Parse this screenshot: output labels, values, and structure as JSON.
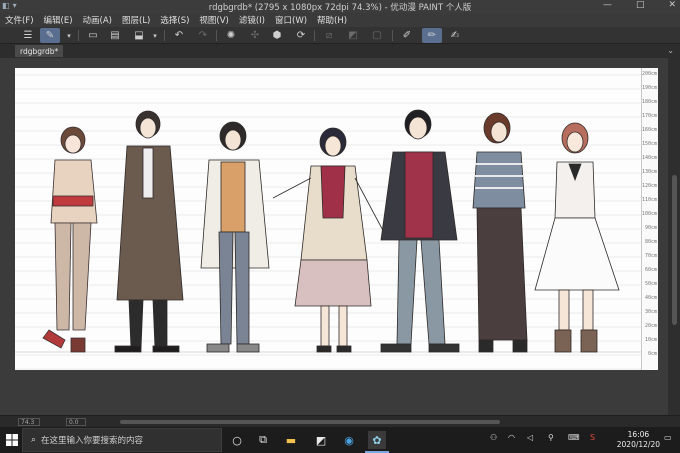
{
  "window": {
    "title": "rdgbgrdb* (2795 x 1080px 72dpi 74.3%)  - 优动漫 PAINT 个人版",
    "controls": [
      "—",
      "□",
      "✕"
    ]
  },
  "menu": [
    "文件(F)",
    "编辑(E)",
    "动画(A)",
    "图层(L)",
    "选择(S)",
    "视图(V)",
    "滤镜(I)",
    "窗口(W)",
    "帮助(H)"
  ],
  "toolbar": {
    "icons": [
      "menu-icon",
      "pen-icon",
      "new-icon",
      "open-icon",
      "save-icon",
      "undo-icon",
      "redo-icon",
      "select-icon",
      "transform-icon",
      "fill-icon",
      "ruler-icon",
      "gradient-icon",
      "frame-icon",
      "pen-tool-icon",
      "pencil-icon",
      "brush-icon"
    ]
  },
  "document_tab": {
    "label": "rdgbgrdb*"
  },
  "canvas": {
    "ruler_labels": [
      "200cm",
      "190cm",
      "180cm",
      "170cm",
      "160cm",
      "150cm",
      "140cm",
      "130cm",
      "120cm",
      "110cm",
      "100cm",
      "90cm",
      "80cm",
      "70cm",
      "60cm",
      "50cm",
      "40cm",
      "30cm",
      "20cm",
      "10cm",
      "0cm"
    ]
  },
  "statusbar": {
    "zoom": "74.3",
    "angle": "0.0"
  },
  "taskbar": {
    "search_placeholder": "在这里输入你要搜索的内容",
    "time": "16:06",
    "date": "2020/12/20",
    "accent": "#7aa7e0"
  }
}
